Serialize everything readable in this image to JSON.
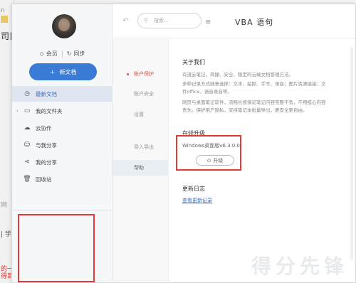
{
  "background": {
    "fragments": [
      "n",
      "",
      "司目",
      "网",
      "| 学",
      "的一",
      "得到"
    ]
  },
  "sidebar": {
    "quick": [
      {
        "icon": "diamond-icon",
        "label": "会员"
      },
      {
        "icon": "sync-icon",
        "label": "同步"
      }
    ],
    "new_button": {
      "icon": "plus-icon",
      "label": "新文档"
    },
    "items": [
      {
        "icon": "clock-icon",
        "label": "最新文档",
        "active": true
      },
      {
        "icon": "folder-icon",
        "label": "我的文件夹",
        "caret": "›"
      },
      {
        "icon": "cloud-user-icon",
        "label": "云协作"
      },
      {
        "icon": "share-user-icon",
        "label": "与我分享"
      },
      {
        "icon": "share-icon",
        "label": "我的分享"
      },
      {
        "icon": "trash-icon",
        "label": "回收站"
      }
    ]
  },
  "topbar": {
    "back_icon": "↶",
    "search_placeholder": "搜索...",
    "menu_icon": "≡",
    "doc_title": "VBA 语句"
  },
  "settings": {
    "items": [
      {
        "label": "账户保护",
        "state": "active"
      },
      {
        "label": "账户安全",
        "state": ""
      },
      {
        "label": "设置",
        "state": ""
      },
      {
        "label": "导入导出",
        "state": ""
      },
      {
        "label": "帮助",
        "state": "current"
      }
    ]
  },
  "about": {
    "title": "关于我们",
    "paragraphs": [
      "有道云笔记，简捷、安全、稳定的云端文档管理方法。",
      "多种记录方式随意选择：文本、拍照、手写、录音；图片资源链接：文件office、语音录音等。",
      "网页与桌面笔记软件，流畅长按保证笔记内容完整不丢，不用担心内容丢失。保护用户隐私，支持笔记本批量导出，更安全更自由。"
    ]
  },
  "version": {
    "title": "在线升级",
    "label": "Windows桌面版v6.3.0.0",
    "upgrade_icon": "⊙",
    "upgrade_label": "升级"
  },
  "changelog": {
    "title": "更新日志",
    "link": "查看更新记录"
  },
  "watermark": "得分先锋"
}
